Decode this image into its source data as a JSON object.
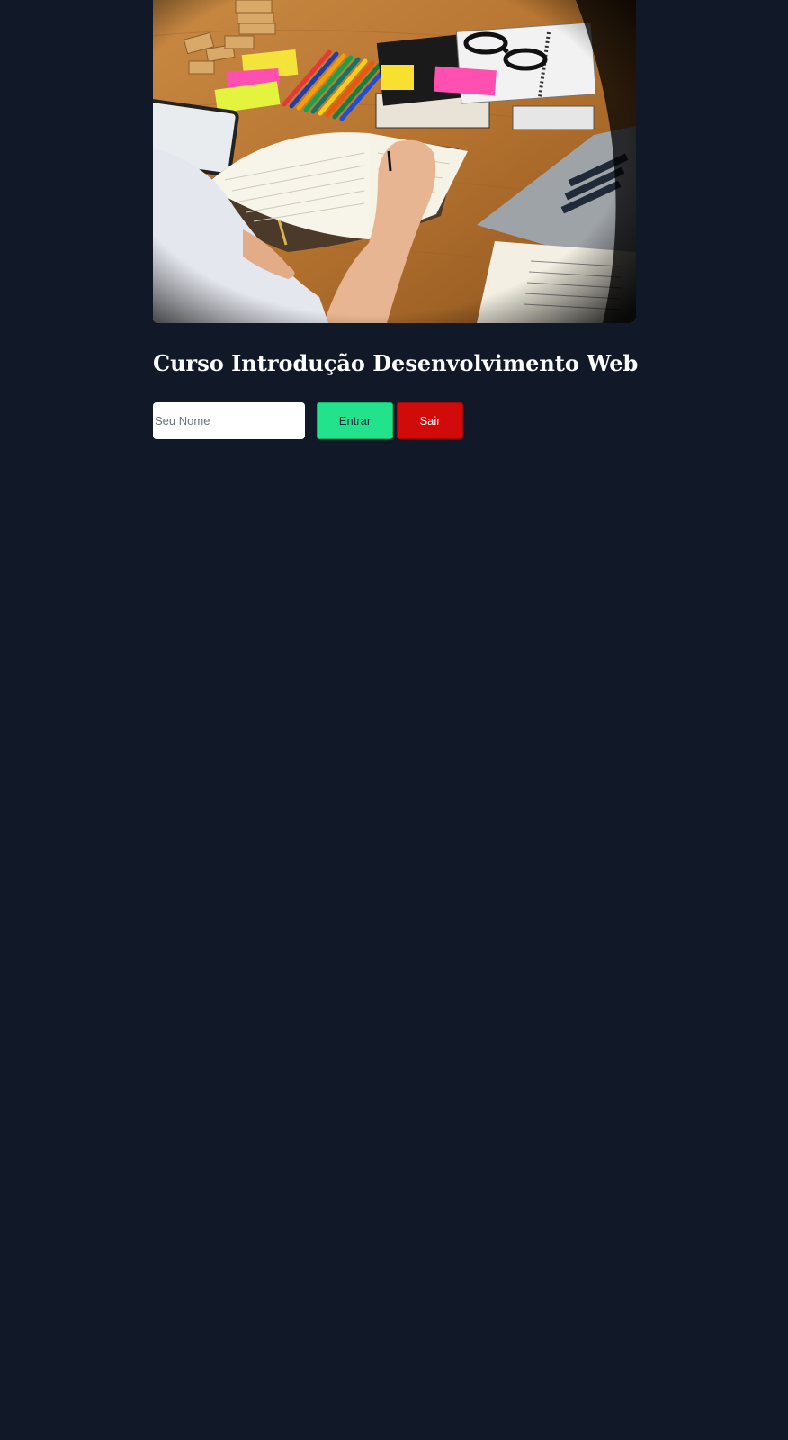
{
  "page": {
    "background": "#111827"
  },
  "hero": {
    "image_alt": "study-desk-photo",
    "icon": "notebook-writing-photo"
  },
  "course": {
    "title": "Curso Introdução Desenvolvimento Web"
  },
  "form": {
    "name_placeholder": "Seu Nome",
    "name_value": "",
    "enter_label": "Entrar",
    "exit_label": "Sair",
    "enter_color": "#22e38c",
    "exit_color": "#d10a0a"
  }
}
